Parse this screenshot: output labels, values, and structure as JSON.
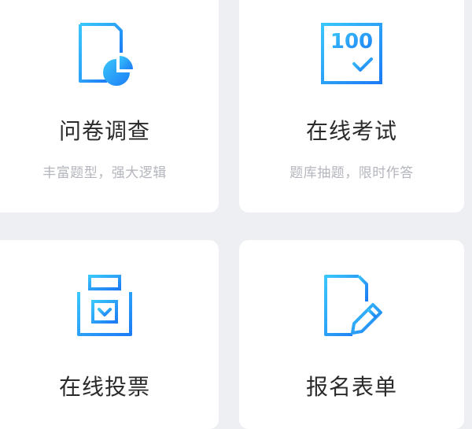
{
  "cards": [
    {
      "title": "问卷调查",
      "desc": "丰富题型，强大逻辑",
      "icon": "survey-document-chart-icon"
    },
    {
      "title": "在线考试",
      "desc": "题库抽题，限时作答",
      "icon": "exam-score-100-icon",
      "icon_text": "100"
    },
    {
      "title": "在线投票",
      "desc": "",
      "icon": "ballot-box-icon"
    },
    {
      "title": "报名表单",
      "desc": "",
      "icon": "form-edit-pencil-icon"
    }
  ],
  "colors": {
    "icon_gradient_start": "#3ac6fb",
    "icon_gradient_end": "#1c7cf5",
    "title": "#2b2b2b",
    "desc": "#b4b6bd",
    "card_bg": "#ffffff",
    "page_bg": "#eeeff3"
  }
}
